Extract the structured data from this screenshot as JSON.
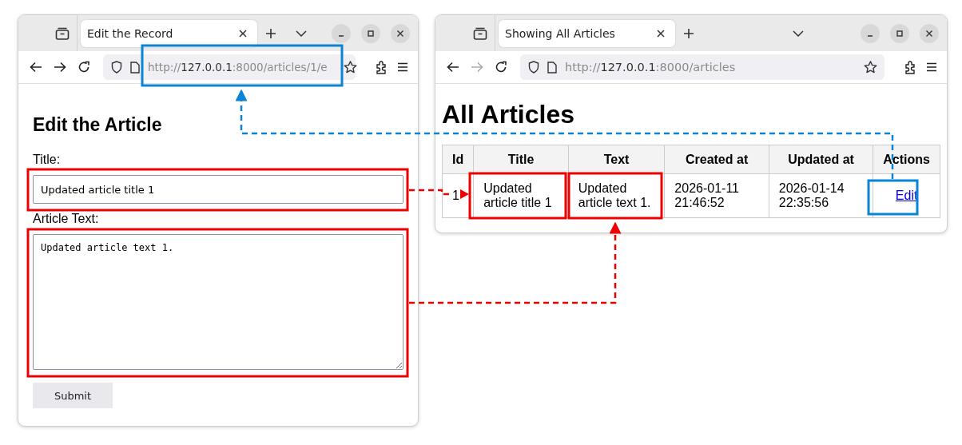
{
  "windows": [
    {
      "kind": "edit_form",
      "tab_title": "Edit the Record",
      "forward_enabled": true,
      "url": {
        "scheme": "http://",
        "host": "127.0.0.1",
        "path": ":8000/articles/1/e"
      },
      "heading": "Edit the Article",
      "form": {
        "title_label": "Title:",
        "title_value": "Updated article title 1",
        "text_label": "Article Text:",
        "text_value": "Updated article text 1.",
        "submit": "Submit"
      }
    },
    {
      "kind": "article_list",
      "tab_title": "Showing All Articles",
      "forward_enabled": false,
      "url": {
        "scheme": "http://",
        "host": "127.0.0.1",
        "path": ":8000/articles"
      },
      "heading": "All Articles",
      "table": {
        "columns": [
          "Id",
          "Title",
          "Text",
          "Created at",
          "Updated at",
          "Actions"
        ],
        "rows": [
          {
            "cells": [
              "1",
              "Updated article title 1",
              "Updated article text 1.",
              "2026-01-11 21:46:52",
              "2026-01-14 22:35:56"
            ],
            "action": "Edit"
          }
        ]
      }
    }
  ]
}
